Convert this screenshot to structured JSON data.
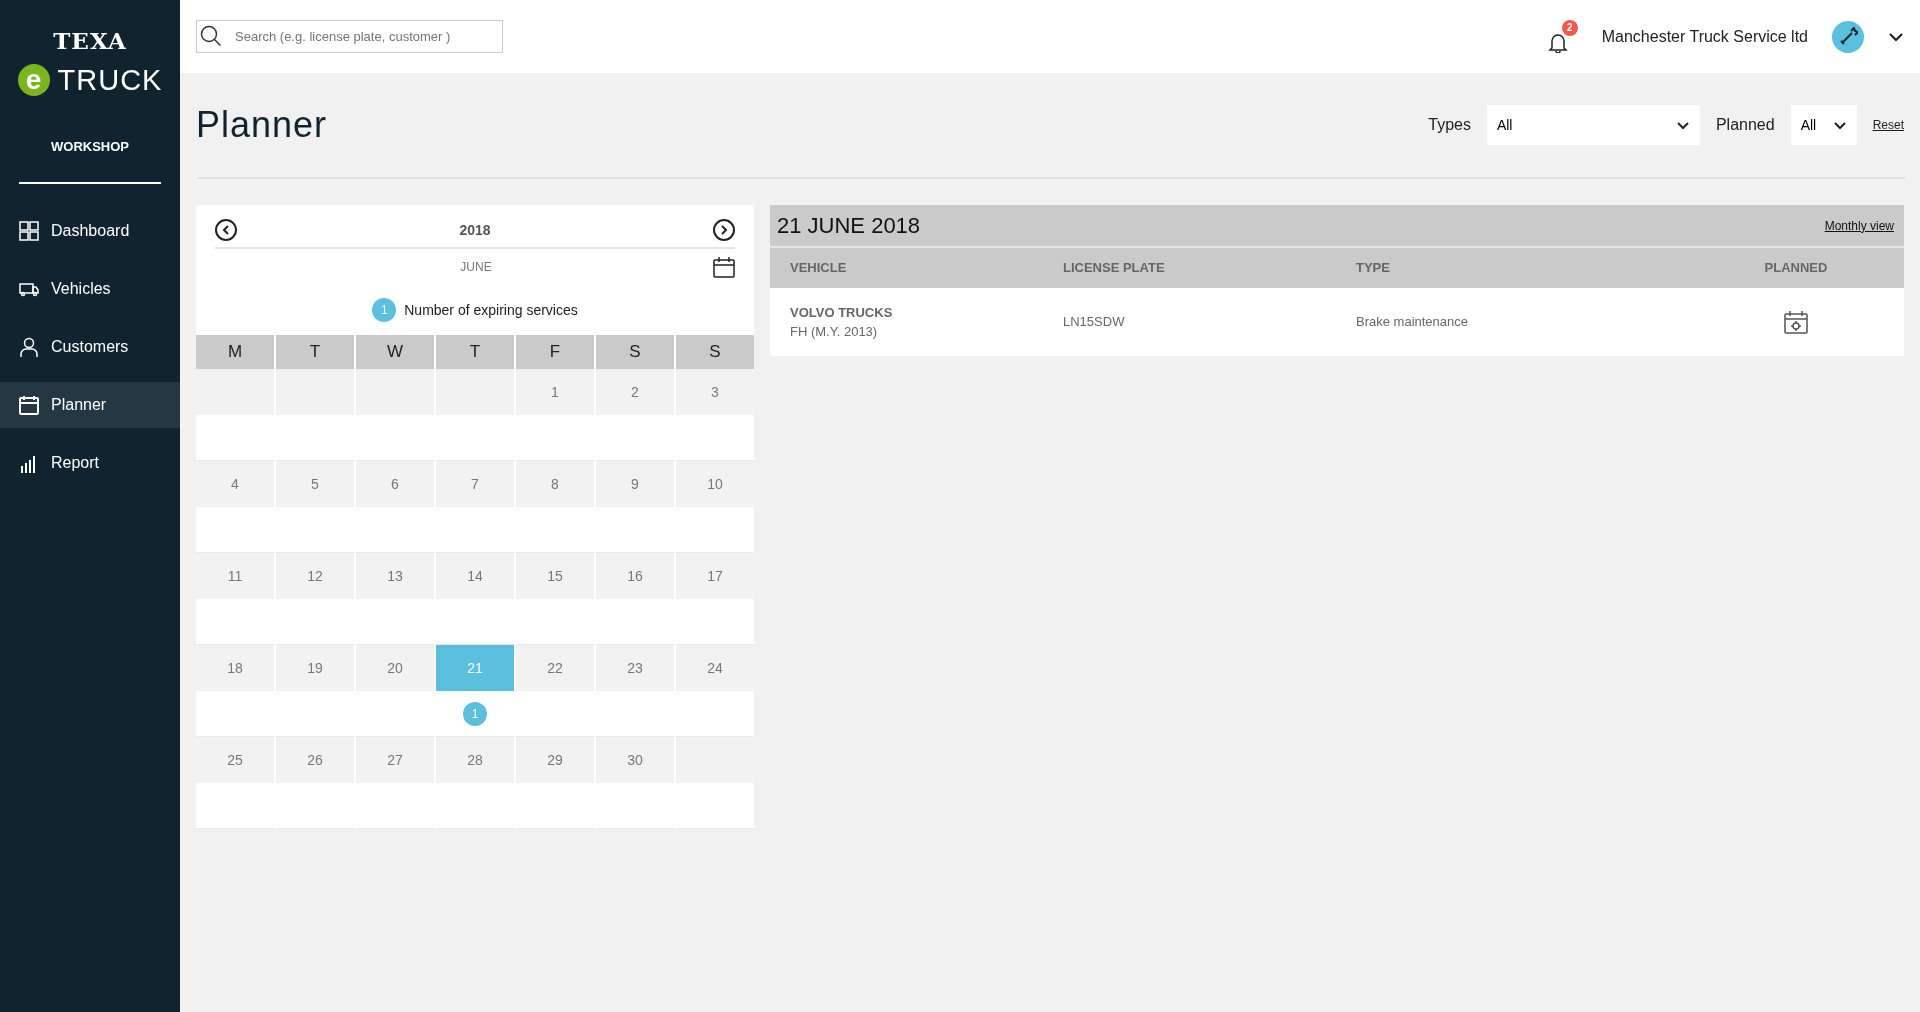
{
  "brand": {
    "top": "TEXA",
    "letter": "e",
    "name": "TRUCK",
    "section": "WORKSHOP"
  },
  "sidebar": {
    "items": [
      {
        "label": "Dashboard",
        "selected": false
      },
      {
        "label": "Vehicles",
        "selected": false
      },
      {
        "label": "Customers",
        "selected": false
      },
      {
        "label": "Planner",
        "selected": true
      },
      {
        "label": "Report",
        "selected": false
      }
    ]
  },
  "topbar": {
    "search": {
      "placeholder": "Search (e.g. license plate, customer )"
    },
    "notifications": "2",
    "company": "Manchester Truck Service ltd"
  },
  "page": {
    "title": "Planner",
    "filters": [
      {
        "label": "Types",
        "value": "All",
        "kind": "wide"
      },
      {
        "label": "Planned",
        "value": "All",
        "kind": "narrow"
      }
    ],
    "reset": "Reset"
  },
  "calendar": {
    "year": "2018",
    "month": "JUNE",
    "legend": {
      "count": "1",
      "label": "Number of expiring services"
    },
    "weekdays": [
      "M",
      "T",
      "W",
      "T",
      "F",
      "S",
      "S"
    ],
    "weeks": [
      [
        {
          "kind": "blank"
        },
        {
          "kind": "blank"
        },
        {
          "kind": "blank"
        },
        {
          "kind": "blank"
        },
        {
          "kind": "day",
          "day": "1",
          "selected": false
        },
        {
          "kind": "day",
          "day": "2",
          "selected": false
        },
        {
          "kind": "day",
          "day": "3",
          "selected": false
        }
      ],
      [
        {
          "kind": "day",
          "day": "4",
          "selected": false
        },
        {
          "kind": "day",
          "day": "5",
          "selected": false
        },
        {
          "kind": "day",
          "day": "6",
          "selected": false
        },
        {
          "kind": "day",
          "day": "7",
          "selected": false
        },
        {
          "kind": "day",
          "day": "8",
          "selected": false
        },
        {
          "kind": "day",
          "day": "9",
          "selected": false
        },
        {
          "kind": "day",
          "day": "10",
          "selected": false
        }
      ],
      [
        {
          "kind": "day",
          "day": "11",
          "selected": false
        },
        {
          "kind": "day",
          "day": "12",
          "selected": false
        },
        {
          "kind": "day",
          "day": "13",
          "selected": false
        },
        {
          "kind": "day",
          "day": "14",
          "selected": false
        },
        {
          "kind": "day",
          "day": "15",
          "selected": false
        },
        {
          "kind": "day",
          "day": "16",
          "selected": false
        },
        {
          "kind": "day",
          "day": "17",
          "selected": false
        }
      ],
      [
        {
          "kind": "day",
          "day": "18",
          "selected": false
        },
        {
          "kind": "day",
          "day": "19",
          "selected": false
        },
        {
          "kind": "day",
          "day": "20",
          "selected": false
        },
        {
          "kind": "day",
          "day": "21",
          "selected": true,
          "count": "1"
        },
        {
          "kind": "day",
          "day": "22",
          "selected": false
        },
        {
          "kind": "day",
          "day": "23",
          "selected": false
        },
        {
          "kind": "day",
          "day": "24",
          "selected": false
        }
      ],
      [
        {
          "kind": "day",
          "day": "25",
          "selected": false
        },
        {
          "kind": "day",
          "day": "26",
          "selected": false
        },
        {
          "kind": "day",
          "day": "27",
          "selected": false
        },
        {
          "kind": "day",
          "day": "28",
          "selected": false
        },
        {
          "kind": "day",
          "day": "29",
          "selected": false
        },
        {
          "kind": "day",
          "day": "30",
          "selected": false
        },
        {
          "kind": "blank"
        }
      ]
    ]
  },
  "detail": {
    "title": "21 JUNE 2018",
    "link": "Monthly view",
    "columns": [
      "VEHICLE",
      "LICENSE PLATE",
      "TYPE",
      "PLANNED"
    ],
    "rows": [
      {
        "make": "VOLVO TRUCKS",
        "model": "FH (M.Y. 2013)",
        "plate": "LN15SDW",
        "type": "Brake maintenance",
        "planned": true
      }
    ]
  }
}
